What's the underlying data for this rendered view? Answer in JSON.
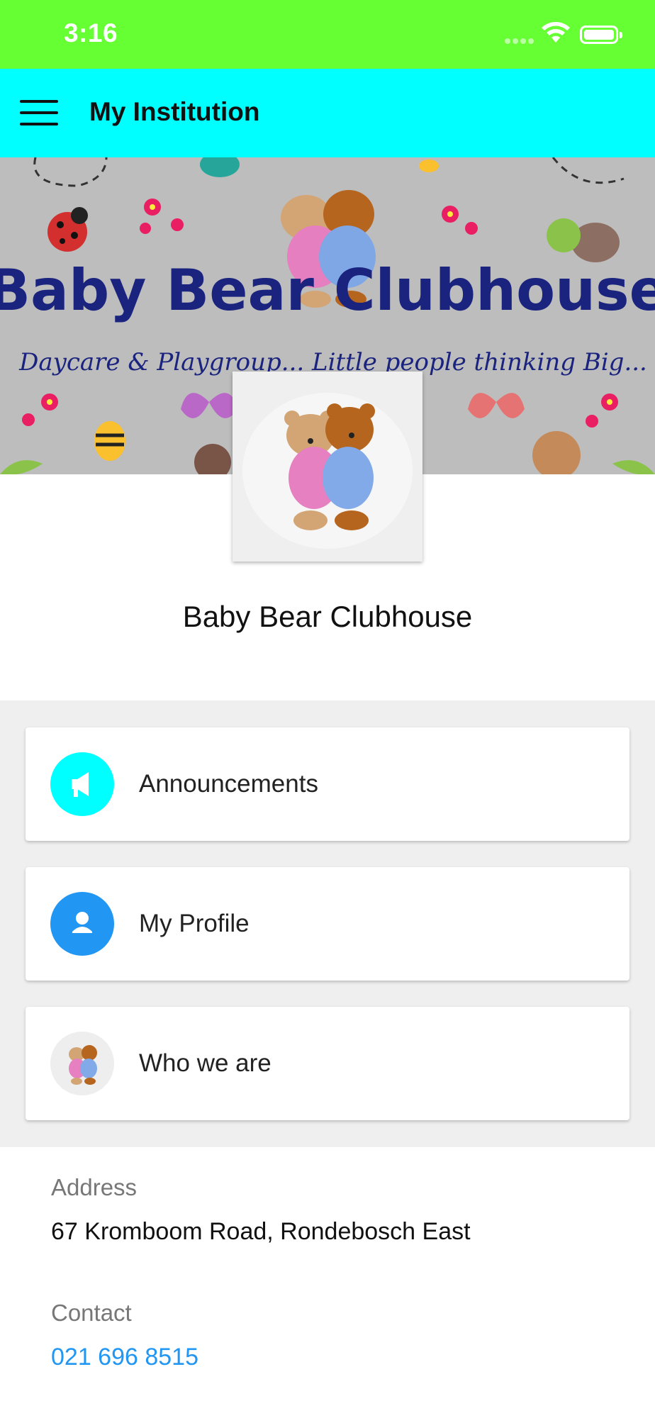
{
  "status_bar": {
    "time": "3:16"
  },
  "app_bar": {
    "title": "My Institution"
  },
  "banner": {
    "title": "Baby Bear Clubhouse",
    "subtitle": "Daycare & Playgroup... Little people thinking Big..."
  },
  "institution": {
    "name": "Baby Bear Clubhouse"
  },
  "menu": {
    "items": [
      {
        "label": "Announcements",
        "icon": "megaphone-icon",
        "color": "#00ffff"
      },
      {
        "label": "My Profile",
        "icon": "person-icon",
        "color": "#2196f3"
      },
      {
        "label": "Who we are",
        "icon": "teddy-bears-icon",
        "color": "#eeeeee"
      }
    ]
  },
  "info": {
    "address_label": "Address",
    "address_value": "67 Kromboom Road, Rondebosch East",
    "contact_label": "Contact",
    "contact_value": "021 696 8515"
  },
  "colors": {
    "status_bar": "#66ff33",
    "app_bar": "#00ffff",
    "link": "#2196f3",
    "banner_text": "#1a237e"
  }
}
